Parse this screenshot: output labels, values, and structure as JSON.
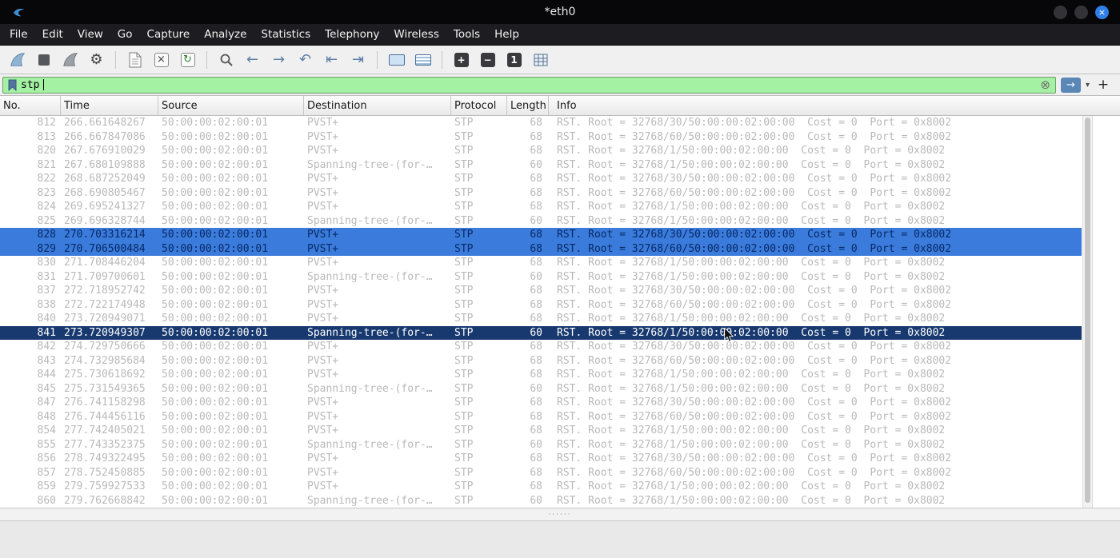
{
  "window": {
    "title": "*eth0",
    "close_glyph": "×"
  },
  "menu": {
    "items": [
      "File",
      "Edit",
      "View",
      "Go",
      "Capture",
      "Analyze",
      "Statistics",
      "Telephony",
      "Wireless",
      "Tools",
      "Help"
    ]
  },
  "toolbar": {
    "items": [
      {
        "name": "start-capture-icon",
        "type": "fin",
        "color": "#8fb3d1",
        "stroke": "#5d84a8"
      },
      {
        "name": "stop-capture-icon",
        "type": "square",
        "color": "#54575b"
      },
      {
        "name": "restart-capture-icon",
        "type": "fin",
        "color": "#9aa0a6",
        "stroke": "#71767c"
      },
      {
        "name": "capture-options-icon",
        "type": "glyph",
        "glyph": "⚙",
        "color": "#3c4043"
      },
      {
        "type": "sep"
      },
      {
        "name": "open-file-icon",
        "type": "doc"
      },
      {
        "name": "close-file-icon",
        "type": "box",
        "glyph": "×",
        "color": "#444444"
      },
      {
        "name": "reload-file-icon",
        "type": "box",
        "glyph": "↻",
        "color": "#2e7d32"
      },
      {
        "type": "sep"
      },
      {
        "name": "find-packet-icon",
        "type": "find"
      },
      {
        "name": "go-back-icon",
        "type": "glyph",
        "glyph": "←",
        "color": "#5f7fa6"
      },
      {
        "name": "go-forward-icon",
        "type": "glyph",
        "glyph": "→",
        "color": "#5f7fa6"
      },
      {
        "name": "go-to-packet-icon",
        "type": "glyph",
        "glyph": "↶",
        "color": "#5f7fa6"
      },
      {
        "name": "previous-packet-icon",
        "type": "glyph",
        "glyph": "⇤",
        "color": "#5f7fa6"
      },
      {
        "name": "next-packet-icon",
        "type": "glyph",
        "glyph": "⇥",
        "color": "#5f7fa6"
      },
      {
        "type": "sep"
      },
      {
        "name": "autoscroll-icon",
        "type": "screen",
        "variant": "plain"
      },
      {
        "name": "colorize-icon",
        "type": "screen",
        "variant": "striped"
      },
      {
        "type": "sep"
      },
      {
        "name": "zoom-in-icon",
        "type": "zoombox",
        "glyph": "+"
      },
      {
        "name": "zoom-out-icon",
        "type": "zoombox",
        "glyph": "−"
      },
      {
        "name": "zoom-original-icon",
        "type": "zoombox",
        "glyph": "1"
      },
      {
        "name": "resize-columns-icon",
        "type": "grid"
      }
    ]
  },
  "filter": {
    "value": "stp",
    "clear_icon": "⊗",
    "apply_glyph": "→",
    "dropdown_glyph": "▾",
    "add_label": "+"
  },
  "colors": {
    "filter_valid_bg": "#a5f1a3",
    "selection_primary_bg": "#17396f",
    "selection_secondary_bg": "#3a7bdb",
    "row_text": "#b9b9b9"
  },
  "table": {
    "columns": [
      "No.",
      "Time",
      "Source",
      "Destination",
      "Protocol",
      "Length",
      "Info"
    ],
    "rows": [
      {
        "no": "812",
        "time": "266.661648267",
        "src": "50:00:00:02:00:01",
        "dst": "PVST+",
        "proto": "STP",
        "len": "68",
        "info": "RST. Root = 32768/30/50:00:00:02:00:00  Cost = 0  Port = 0x8002",
        "state": "normal"
      },
      {
        "no": "813",
        "time": "266.667847086",
        "src": "50:00:00:02:00:01",
        "dst": "PVST+",
        "proto": "STP",
        "len": "68",
        "info": "RST. Root = 32768/60/50:00:00:02:00:00  Cost = 0  Port = 0x8002",
        "state": "normal"
      },
      {
        "no": "820",
        "time": "267.676910029",
        "src": "50:00:00:02:00:01",
        "dst": "PVST+",
        "proto": "STP",
        "len": "68",
        "info": "RST. Root = 32768/1/50:00:00:02:00:00  Cost = 0  Port = 0x8002",
        "state": "normal"
      },
      {
        "no": "821",
        "time": "267.680109888",
        "src": "50:00:00:02:00:01",
        "dst": "Spanning-tree-(for-…",
        "proto": "STP",
        "len": "60",
        "info": "RST. Root = 32768/1/50:00:00:02:00:00  Cost = 0  Port = 0x8002",
        "state": "normal"
      },
      {
        "no": "822",
        "time": "268.687252049",
        "src": "50:00:00:02:00:01",
        "dst": "PVST+",
        "proto": "STP",
        "len": "68",
        "info": "RST. Root = 32768/30/50:00:00:02:00:00  Cost = 0  Port = 0x8002",
        "state": "normal"
      },
      {
        "no": "823",
        "time": "268.690805467",
        "src": "50:00:00:02:00:01",
        "dst": "PVST+",
        "proto": "STP",
        "len": "68",
        "info": "RST. Root = 32768/60/50:00:00:02:00:00  Cost = 0  Port = 0x8002",
        "state": "normal"
      },
      {
        "no": "824",
        "time": "269.695241327",
        "src": "50:00:00:02:00:01",
        "dst": "PVST+",
        "proto": "STP",
        "len": "68",
        "info": "RST. Root = 32768/1/50:00:00:02:00:00  Cost = 0  Port = 0x8002",
        "state": "normal"
      },
      {
        "no": "825",
        "time": "269.696328744",
        "src": "50:00:00:02:00:01",
        "dst": "Spanning-tree-(for-…",
        "proto": "STP",
        "len": "60",
        "info": "RST. Root = 32768/1/50:00:00:02:00:00  Cost = 0  Port = 0x8002",
        "state": "normal"
      },
      {
        "no": "828",
        "time": "270.703316214",
        "src": "50:00:00:02:00:01",
        "dst": "PVST+",
        "proto": "STP",
        "len": "68",
        "info": "RST. Root = 32768/30/50:00:00:02:00:00  Cost = 0  Port = 0x8002",
        "state": "selected-secondary"
      },
      {
        "no": "829",
        "time": "270.706500484",
        "src": "50:00:00:02:00:01",
        "dst": "PVST+",
        "proto": "STP",
        "len": "68",
        "info": "RST. Root = 32768/60/50:00:00:02:00:00  Cost = 0  Port = 0x8002",
        "state": "selected-secondary"
      },
      {
        "no": "830",
        "time": "271.708446204",
        "src": "50:00:00:02:00:01",
        "dst": "PVST+",
        "proto": "STP",
        "len": "68",
        "info": "RST. Root = 32768/1/50:00:00:02:00:00  Cost = 0  Port = 0x8002",
        "state": "normal"
      },
      {
        "no": "831",
        "time": "271.709700601",
        "src": "50:00:00:02:00:01",
        "dst": "Spanning-tree-(for-…",
        "proto": "STP",
        "len": "60",
        "info": "RST. Root = 32768/1/50:00:00:02:00:00  Cost = 0  Port = 0x8002",
        "state": "normal"
      },
      {
        "no": "837",
        "time": "272.718952742",
        "src": "50:00:00:02:00:01",
        "dst": "PVST+",
        "proto": "STP",
        "len": "68",
        "info": "RST. Root = 32768/30/50:00:00:02:00:00  Cost = 0  Port = 0x8002",
        "state": "normal"
      },
      {
        "no": "838",
        "time": "272.722174948",
        "src": "50:00:00:02:00:01",
        "dst": "PVST+",
        "proto": "STP",
        "len": "68",
        "info": "RST. Root = 32768/60/50:00:00:02:00:00  Cost = 0  Port = 0x8002",
        "state": "normal"
      },
      {
        "no": "840",
        "time": "273.720949071",
        "src": "50:00:00:02:00:01",
        "dst": "PVST+",
        "proto": "STP",
        "len": "68",
        "info": "RST. Root = 32768/1/50:00:00:02:00:00  Cost = 0  Port = 0x8002",
        "state": "normal"
      },
      {
        "no": "841",
        "time": "273.720949307",
        "src": "50:00:00:02:00:01",
        "dst": "Spanning-tree-(for-…",
        "proto": "STP",
        "len": "60",
        "info": "RST. Root = 32768/1/50:00:00:02:00:00  Cost = 0  Port = 0x8002",
        "state": "selected"
      },
      {
        "no": "842",
        "time": "274.729750666",
        "src": "50:00:00:02:00:01",
        "dst": "PVST+",
        "proto": "STP",
        "len": "68",
        "info": "RST. Root = 32768/30/50:00:00:02:00:00  Cost = 0  Port = 0x8002",
        "state": "normal"
      },
      {
        "no": "843",
        "time": "274.732985684",
        "src": "50:00:00:02:00:01",
        "dst": "PVST+",
        "proto": "STP",
        "len": "68",
        "info": "RST. Root = 32768/60/50:00:00:02:00:00  Cost = 0  Port = 0x8002",
        "state": "normal"
      },
      {
        "no": "844",
        "time": "275.730618692",
        "src": "50:00:00:02:00:01",
        "dst": "PVST+",
        "proto": "STP",
        "len": "68",
        "info": "RST. Root = 32768/1/50:00:00:02:00:00  Cost = 0  Port = 0x8002",
        "state": "normal"
      },
      {
        "no": "845",
        "time": "275.731549365",
        "src": "50:00:00:02:00:01",
        "dst": "Spanning-tree-(for-…",
        "proto": "STP",
        "len": "60",
        "info": "RST. Root = 32768/1/50:00:00:02:00:00  Cost = 0  Port = 0x8002",
        "state": "normal"
      },
      {
        "no": "847",
        "time": "276.741158298",
        "src": "50:00:00:02:00:01",
        "dst": "PVST+",
        "proto": "STP",
        "len": "68",
        "info": "RST. Root = 32768/30/50:00:00:02:00:00  Cost = 0  Port = 0x8002",
        "state": "normal"
      },
      {
        "no": "848",
        "time": "276.744456116",
        "src": "50:00:00:02:00:01",
        "dst": "PVST+",
        "proto": "STP",
        "len": "68",
        "info": "RST. Root = 32768/60/50:00:00:02:00:00  Cost = 0  Port = 0x8002",
        "state": "normal"
      },
      {
        "no": "854",
        "time": "277.742405021",
        "src": "50:00:00:02:00:01",
        "dst": "PVST+",
        "proto": "STP",
        "len": "68",
        "info": "RST. Root = 32768/1/50:00:00:02:00:00  Cost = 0  Port = 0x8002",
        "state": "normal"
      },
      {
        "no": "855",
        "time": "277.743352375",
        "src": "50:00:00:02:00:01",
        "dst": "Spanning-tree-(for-…",
        "proto": "STP",
        "len": "60",
        "info": "RST. Root = 32768/1/50:00:00:02:00:00  Cost = 0  Port = 0x8002",
        "state": "normal"
      },
      {
        "no": "856",
        "time": "278.749322495",
        "src": "50:00:00:02:00:01",
        "dst": "PVST+",
        "proto": "STP",
        "len": "68",
        "info": "RST. Root = 32768/30/50:00:00:02:00:00  Cost = 0  Port = 0x8002",
        "state": "normal"
      },
      {
        "no": "857",
        "time": "278.752450885",
        "src": "50:00:00:02:00:01",
        "dst": "PVST+",
        "proto": "STP",
        "len": "68",
        "info": "RST. Root = 32768/60/50:00:00:02:00:00  Cost = 0  Port = 0x8002",
        "state": "normal"
      },
      {
        "no": "859",
        "time": "279.759927533",
        "src": "50:00:00:02:00:01",
        "dst": "PVST+",
        "proto": "STP",
        "len": "68",
        "info": "RST. Root = 32768/1/50:00:00:02:00:00  Cost = 0  Port = 0x8002",
        "state": "normal"
      },
      {
        "no": "860",
        "time": "279.762668842",
        "src": "50:00:00:02:00:01",
        "dst": "Spanning-tree-(for-…",
        "proto": "STP",
        "len": "60",
        "info": "RST. Root = 32768/1/50:00:00:02:00:00  Cost = 0  Port = 0x8002",
        "state": "normal"
      }
    ]
  }
}
